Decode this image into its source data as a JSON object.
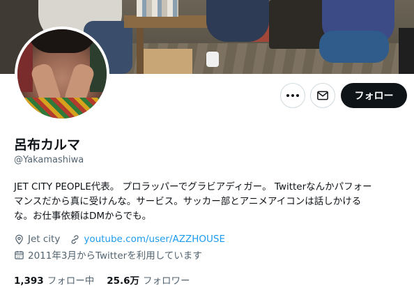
{
  "profile": {
    "display_name": "呂布カルマ",
    "handle": "@Yakamashiwa",
    "bio_lines": [
      "JET CITY PEOPLE代表。 プロラッパーでグラビアディガー。 Twitterなんかパフォー",
      "マンスだから真に受けんな。サービス。サッカー部とアニメアイコンは話しかける",
      "な。お仕事依頼はDMからでも。"
    ],
    "location": "Jet city",
    "website": "youtube.com/user/AZZHOUSE",
    "joined": "2011年3月からTwitterを利用しています"
  },
  "actions": {
    "more_icon": "more-horizontal-icon",
    "message_icon": "envelope-icon",
    "follow_label": "フォロー"
  },
  "stats": {
    "following_count": "1,393",
    "following_label": "フォロー中",
    "followers_count": "25.6万",
    "followers_label": "フォロワー"
  },
  "colors": {
    "primary_text": "#0f1419",
    "secondary_text": "#536471",
    "link": "#1d9bf0",
    "follow_button_bg": "#0f1419",
    "follow_button_text": "#ffffff"
  }
}
